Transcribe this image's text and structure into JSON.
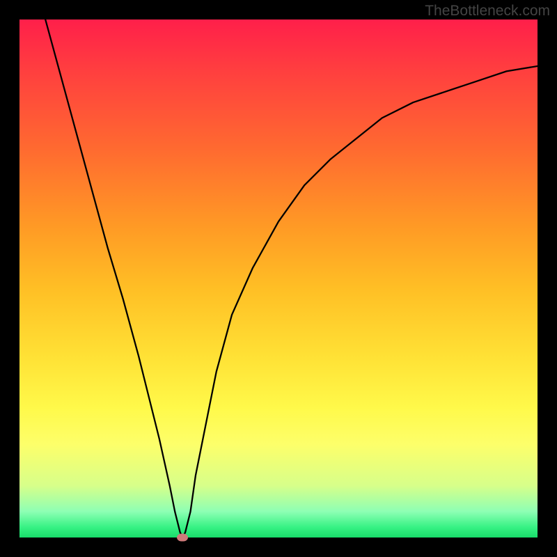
{
  "attribution": "TheBottleneck.com",
  "chart_data": {
    "type": "line",
    "title": "",
    "xlabel": "",
    "ylabel": "",
    "xlim": [
      0,
      100
    ],
    "ylim": [
      0,
      100
    ],
    "series": [
      {
        "name": "bottleneck-curve",
        "x": [
          5,
          8,
          11,
          14,
          17,
          20,
          23,
          25,
          27,
          29,
          30,
          31,
          31.5,
          32,
          33,
          34,
          36,
          38,
          41,
          45,
          50,
          55,
          60,
          65,
          70,
          76,
          82,
          88,
          94,
          100
        ],
        "y": [
          100,
          89,
          78,
          67,
          56,
          46,
          35,
          27,
          19,
          10,
          5,
          1,
          0,
          1,
          5,
          12,
          22,
          32,
          43,
          52,
          61,
          68,
          73,
          77,
          81,
          84,
          86,
          88,
          90,
          91
        ]
      }
    ],
    "marker": {
      "x": 31.5,
      "y": 0
    },
    "background_gradient": {
      "type": "vertical",
      "stops": [
        {
          "pos": 0,
          "color": "#ff1f4a"
        },
        {
          "pos": 0.5,
          "color": "#ffcc30"
        },
        {
          "pos": 0.82,
          "color": "#fdff6a"
        },
        {
          "pos": 1.0,
          "color": "#18dc6a"
        }
      ]
    }
  }
}
